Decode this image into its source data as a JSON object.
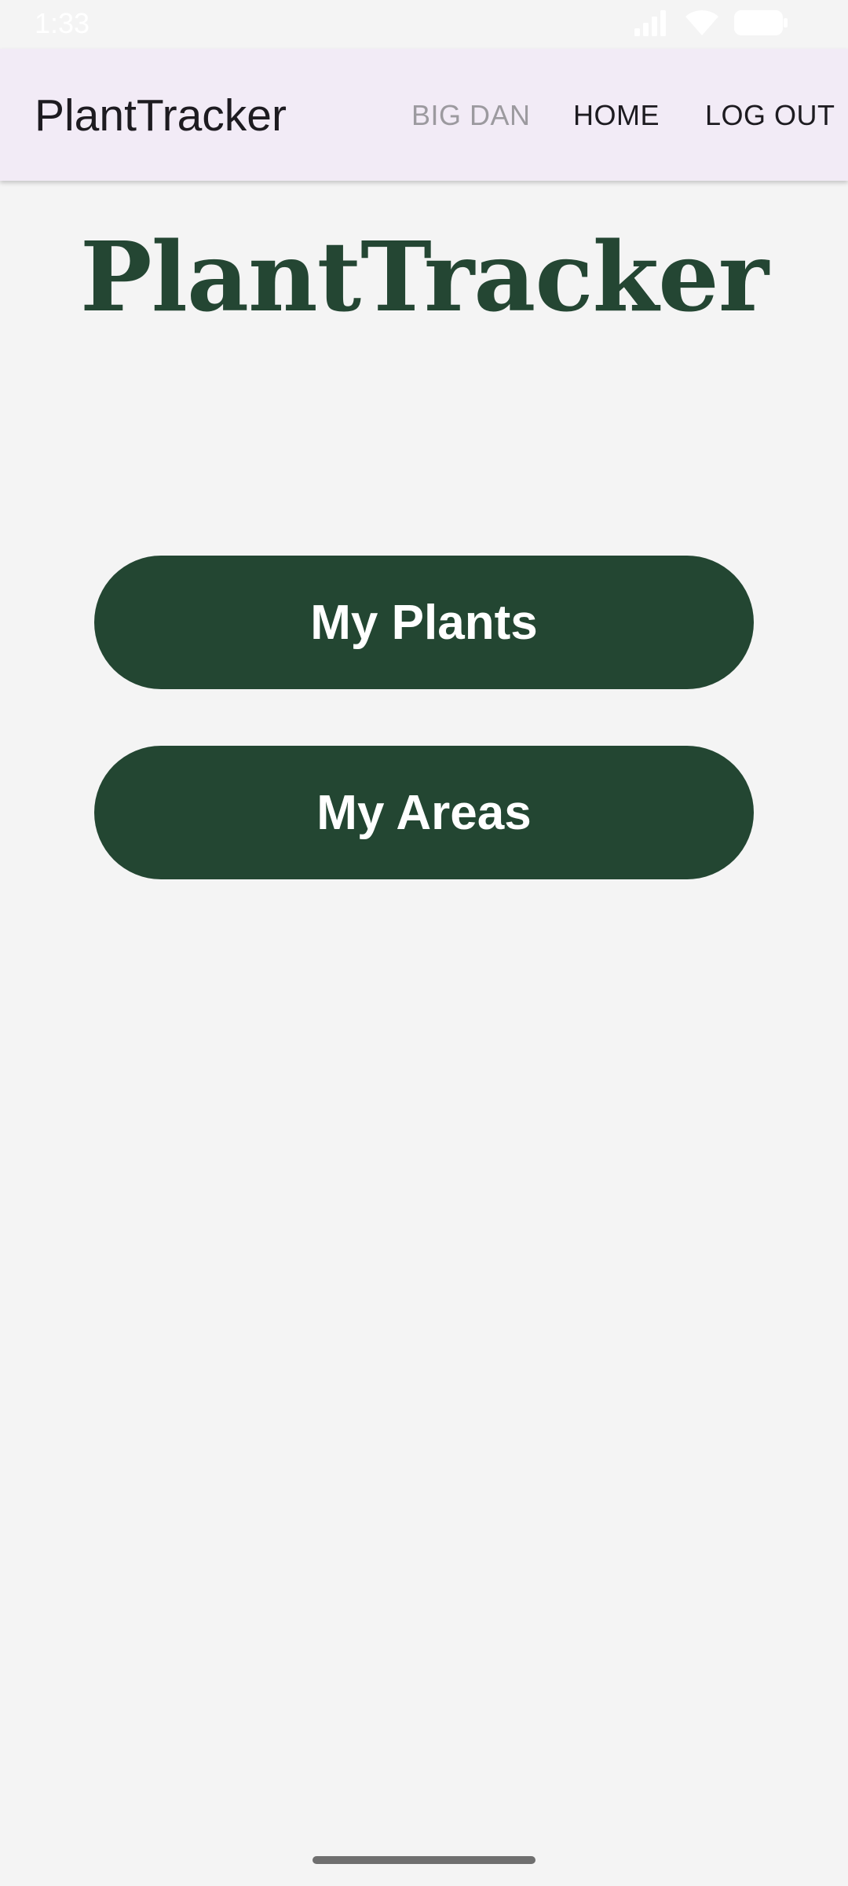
{
  "status_bar": {
    "time": "1:33",
    "icons": [
      "signal-icon",
      "wifi-icon",
      "battery-icon"
    ]
  },
  "app_bar": {
    "title": "PlantTracker",
    "user_label": "BIG DAN",
    "home_label": "HOME",
    "logout_label": "LOG OUT",
    "background": "#f2ebf6"
  },
  "main": {
    "heading": "PlantTracker",
    "heading_color": "#244633",
    "buttons": [
      {
        "label": "My Plants"
      },
      {
        "label": "My Areas"
      }
    ],
    "button_color": "#234632"
  }
}
